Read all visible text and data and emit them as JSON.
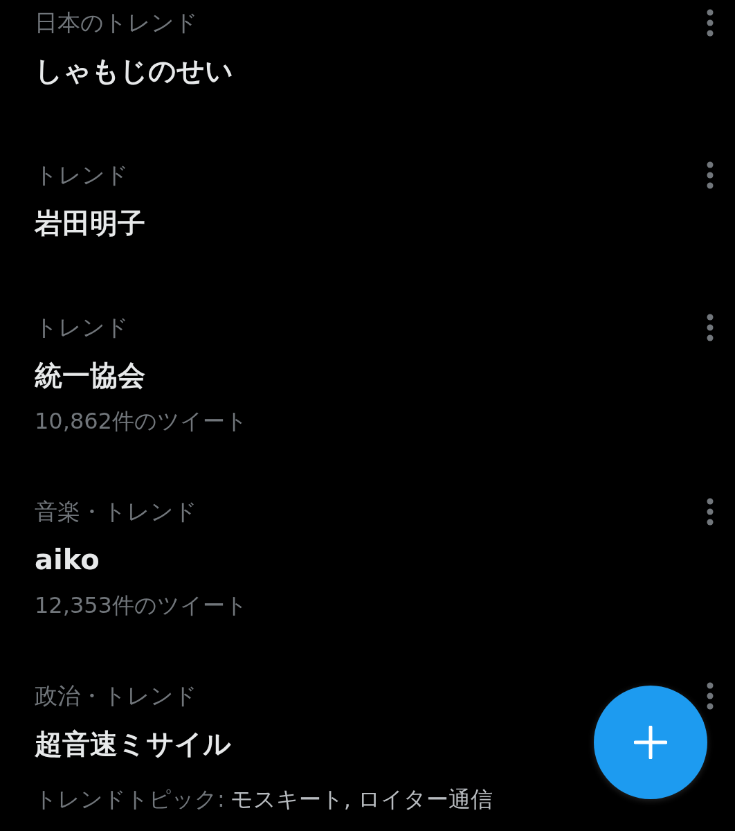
{
  "trends": [
    {
      "category": "日本のトレンド",
      "title": "しゃもじのせい"
    },
    {
      "category": "トレンド",
      "title": "岩田明子"
    },
    {
      "category": "トレンド",
      "title": "統一協会",
      "tweet_count": "10,862件のツイート"
    },
    {
      "category": "音楽・トレンド",
      "title": "aiko",
      "tweet_count": "12,353件のツイート"
    },
    {
      "category": "政治・トレンド",
      "title": "超音速ミサイル",
      "topics": {
        "label": "トレンドトピック:",
        "value": "モスキート, ロイター通信"
      }
    }
  ]
}
